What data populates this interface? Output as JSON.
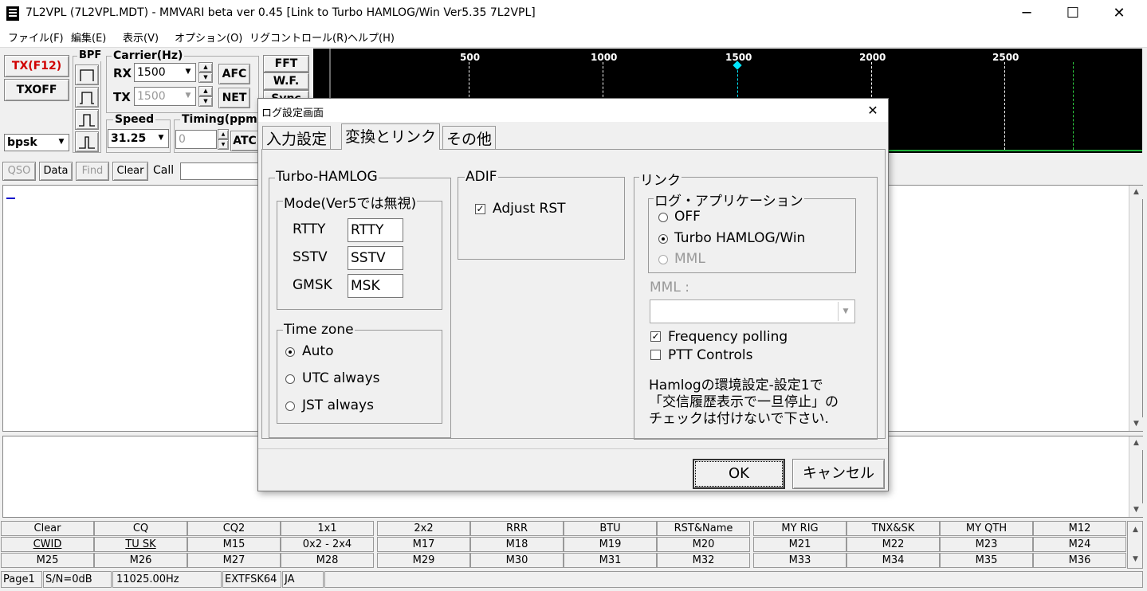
{
  "window": {
    "title": "7L2VPL (7L2VPL.MDT) - MMVARI beta ver 0.45 [Link to Turbo HAMLOG/Win Ver5.35 7L2VPL]",
    "minimize": "─",
    "maximize": "☐",
    "close": "✕"
  },
  "menu": [
    "ファイル(F)",
    "編集(E)",
    "表示(V)",
    "オプション(O)",
    "リグコントロール(R)",
    "ヘルプ(H)"
  ],
  "toolbar": {
    "tx_label": "TX(F12)",
    "txoff_label": "TXOFF",
    "mode_value": "bpsk",
    "bpf_label": "BPF",
    "carrier_label": "Carrier(Hz)",
    "rx_label": "RX",
    "rx_value": "1500",
    "tx_label2": "TX",
    "tx_value": "1500",
    "afc_label": "AFC",
    "net_label": "NET",
    "speed_label": "Speed",
    "speed_value": "31.25",
    "timing_label": "Timing(ppm)",
    "timing_value": "0",
    "atc_label": "ATC",
    "fft_label": "FFT",
    "wf_label": "W.F.",
    "sync_label": "Sync"
  },
  "row2": {
    "qso": "QSO",
    "data": "Data",
    "find": "Find",
    "clear": "Clear",
    "call": "Call"
  },
  "spectrum": {
    "freq_labels": [
      "500",
      "1000",
      "1500",
      "2000",
      "2500"
    ],
    "marker_color": "#00e5ff"
  },
  "macros": [
    [
      "Clear",
      "CQ",
      "CQ2",
      "1x1",
      "2x2",
      "RRR",
      "BTU",
      "RST&Name",
      "MY RIG",
      "TNX&SK",
      "MY QTH",
      "M12"
    ],
    [
      "CWID",
      "TU SK",
      "M15",
      "0x2 - 2x4",
      "M17",
      "M18",
      "M19",
      "M20",
      "M21",
      "M22",
      "M23",
      "M24"
    ],
    [
      "M25",
      "M26",
      "M27",
      "M28",
      "M29",
      "M30",
      "M31",
      "M32",
      "M33",
      "M34",
      "M35",
      "M36"
    ]
  ],
  "status": {
    "page": "Page1",
    "sn": "S/N=0dB",
    "freq": "11025.00Hz",
    "ext": "EXTFSK64",
    "lang": "JA"
  },
  "dialog": {
    "title": "ログ設定画面",
    "close": "✕",
    "tabs": [
      "入力設定",
      "変換とリンク",
      "その他"
    ],
    "active_tab": 1,
    "turbo": {
      "label": "Turbo-HAMLOG",
      "mode_label": "Mode(Ver5では無視)",
      "rows": [
        {
          "label": "RTTY",
          "value": "RTTY"
        },
        {
          "label": "SSTV",
          "value": "SSTV"
        },
        {
          "label": "GMSK",
          "value": "MSK"
        }
      ]
    },
    "timezone": {
      "label": "Time zone",
      "options": [
        "Auto",
        "UTC always",
        "JST always"
      ],
      "selected": 0
    },
    "adif": {
      "label": "ADIF",
      "adjust_rst": "Adjust RST",
      "adjust_rst_checked": true
    },
    "link": {
      "label": "リンク",
      "app_label": "ログ・アプリケーション",
      "options": [
        "OFF",
        "Turbo HAMLOG/Win",
        "MML"
      ],
      "selected": 1,
      "mml_label": "MML :",
      "mml_value": "",
      "freq_polling": "Frequency polling",
      "freq_polling_checked": true,
      "ptt_controls": "PTT Controls",
      "ptt_checked": false,
      "note_lines": [
        "Hamlogの環境設定-設定1で",
        "「交信履歴表示で一旦停止」の",
        "チェックは付けないで下さい."
      ]
    },
    "ok": "OK",
    "cancel": "キャンセル"
  }
}
